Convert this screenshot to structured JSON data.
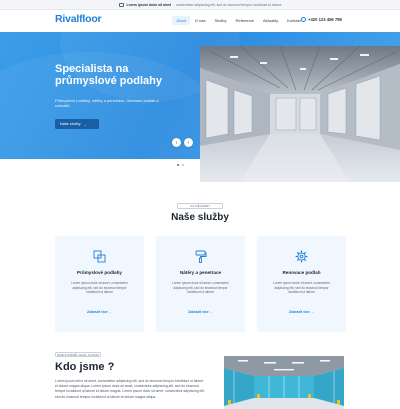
{
  "topbar": {
    "strong": "Lorem ipsum dolor sit amet",
    "text": ", consectetur adipiscing elit, sed do eiusmod tempor incididunt ut labore"
  },
  "header": {
    "logo": "Rivalfloor",
    "nav": [
      "Úvod",
      "O nás",
      "Služby",
      "Reference",
      "Aktuality",
      "Kontakt"
    ],
    "active_index": 0,
    "phone": "+420 123 456 789"
  },
  "hero": {
    "title": "Specialista na průmyslové podlahy",
    "text": "Průmyslové podlahy, nátěry a penetrace, renovace podlah a schodišť.",
    "button": "Naše služby",
    "dots": 2
  },
  "services": {
    "badge": "CO DĚLÁME?",
    "title": "Naše služby",
    "cards": [
      {
        "icon": "floor-layers-icon",
        "title": "Průmyslové podlahy",
        "text": "Lorem ipsum dolor sit amet, consectetur adipiscing elit, sed do eiusmod tempor incididunt ut labore",
        "link": "Zobrazit více →"
      },
      {
        "icon": "paint-roller-icon",
        "title": "Nátěry a penetrace",
        "text": "Lorem ipsum dolor sit amet, consectetur adipiscing elit, sed do eiusmod tempor incididunt ut labore",
        "link": "Zobrazit více →"
      },
      {
        "icon": "gear-icon",
        "title": "Renovace podlah",
        "text": "Lorem ipsum dolor sit amet, consectetur adipiscing elit, sed do eiusmod tempor incididunt ut labore",
        "link": "Zobrazit více →"
      }
    ]
  },
  "about": {
    "badge": "ODE 8 FIRMĚ JAVAL FLOOR",
    "title": "Kdo jsme ?",
    "text": "Lorem ipsum dolor sit amet, consectetur adipiscing elit, sed do eiusmod tempor incididunt ut labore et dolore magna aliqua. Lorem ipsum dolor sit amet, consectetur adipiscing elit, sed do eiusmod tempor incididunt ut labore et dolore magna. Lorem ipsum dolor sit amet, consectetur adipiscing elit, sed do eiusmod tempor incididunt ut labore et dolore magna aliqua."
  },
  "colors": {
    "brand": "#1f7fd6",
    "hero_bg": "#2b8be0",
    "card_bg": "#f0f7fe",
    "button_dark": "#1a5ea3"
  }
}
